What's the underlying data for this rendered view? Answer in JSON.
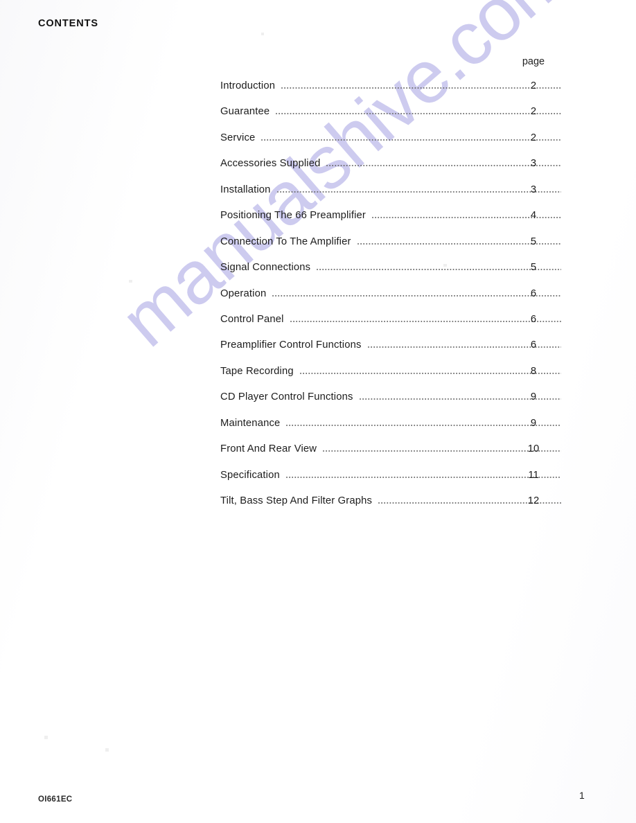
{
  "document": {
    "title": "CONTENTS",
    "page_column_header": "page",
    "watermark": "manualshive.com",
    "watermark_color": "#c9c7ee"
  },
  "toc": {
    "entries": [
      {
        "label": "Introduction",
        "page": "2"
      },
      {
        "label": "Guarantee",
        "page": "2"
      },
      {
        "label": "Service",
        "page": "2"
      },
      {
        "label": "Accessories Supplied",
        "page": "3"
      },
      {
        "label": "Installation",
        "page": "3"
      },
      {
        "label": "Positioning The 66 Preamplifier",
        "page": "4"
      },
      {
        "label": "Connection To The Amplifier",
        "page": "5"
      },
      {
        "label": "Signal Connections",
        "page": "5"
      },
      {
        "label": "Operation",
        "page": "6"
      },
      {
        "label": "Control Panel",
        "page": "6"
      },
      {
        "label": "Preamplifier Control Functions",
        "page": "6"
      },
      {
        "label": "Tape Recording",
        "page": "8"
      },
      {
        "label": "CD Player Control Functions",
        "page": "9"
      },
      {
        "label": "Maintenance",
        "page": "9"
      },
      {
        "label": "Front And Rear View",
        "page": "10"
      },
      {
        "label": "Specification",
        "page": "11"
      },
      {
        "label": "Tilt, Bass Step And Filter Graphs",
        "page": "12"
      }
    ]
  },
  "footer": {
    "code": "OI661EC",
    "page_number": "1"
  }
}
